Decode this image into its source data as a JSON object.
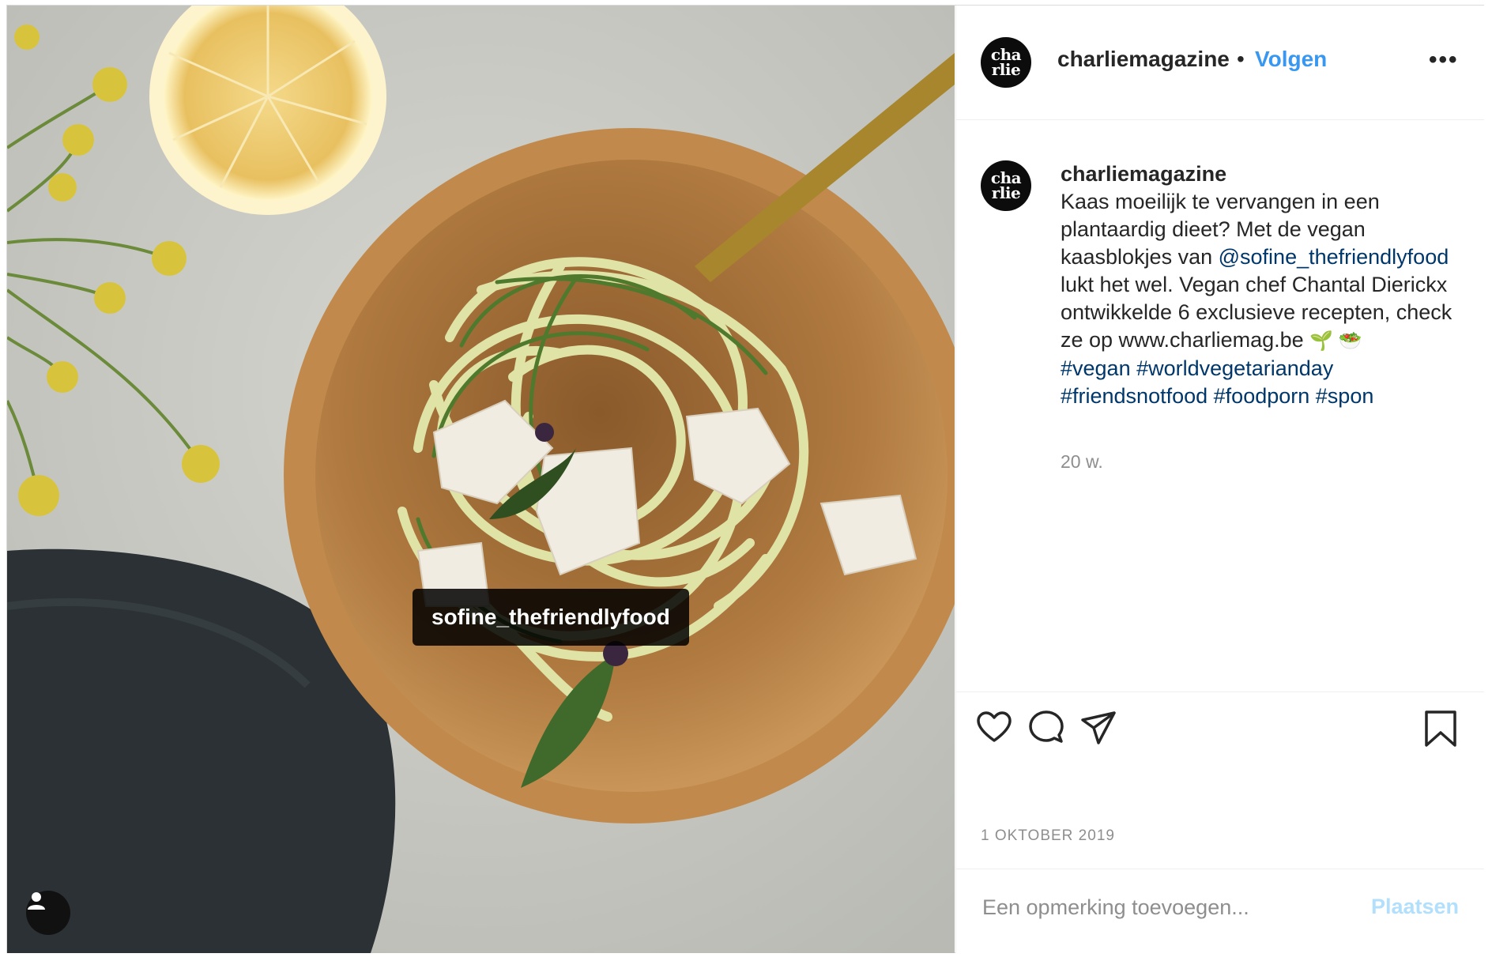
{
  "post": {
    "username": "charliemagazine",
    "separator": "•",
    "follow_label": "Volgen",
    "more_label": "•••",
    "avatar_text_line1": "cha",
    "avatar_text_line2": "rlie",
    "photo_tag": "sofine_thefriendlyfood",
    "caption": {
      "author": "charliemagazine",
      "text_1": "Kaas moeilijk te vervangen in een plantaardig dieet? Met de vegan kaasblokjes van ",
      "mention": "@sofine_thefriendlyfood",
      "text_2": " lukt het wel. Vegan chef Chantal Dierickx ontwikkelde 6 exclusieve recepten, check ze op www.charliemag.be ",
      "emojis": "🌱 🥗",
      "hashtags": [
        "#vegan",
        "#worldvegetarianday",
        "#friendsnotfood",
        "#foodporn",
        "#spon"
      ]
    },
    "relative_time": "20 w.",
    "date": "1 OKTOBER 2019",
    "comment_placeholder": "Een opmerking toevoegen...",
    "post_button": "Plaatsen",
    "icons": [
      "heart-icon",
      "comment-icon",
      "share-icon",
      "bookmark-icon",
      "user-tag-icon"
    ]
  }
}
